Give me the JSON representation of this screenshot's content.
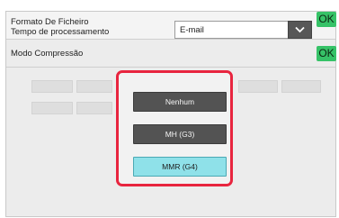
{
  "header": {
    "format_label": "Formato De Ficheiro",
    "processing_label": "Tempo de processamento",
    "format_value": "E-mail",
    "ok_label": "OK"
  },
  "compression": {
    "label": "Modo Compressão",
    "ok_label": "OK",
    "options": [
      {
        "label": "Nenhum",
        "selected": false
      },
      {
        "label": "MH (G3)",
        "selected": false
      },
      {
        "label": "MMR (G4)",
        "selected": true
      }
    ]
  },
  "colors": {
    "ok_green": "#36c267",
    "highlight_red": "#e8253f",
    "selected_cyan": "#8fe1e9",
    "button_dark": "#535353"
  },
  "icons": {
    "dropdown": "chevron-down-icon"
  }
}
